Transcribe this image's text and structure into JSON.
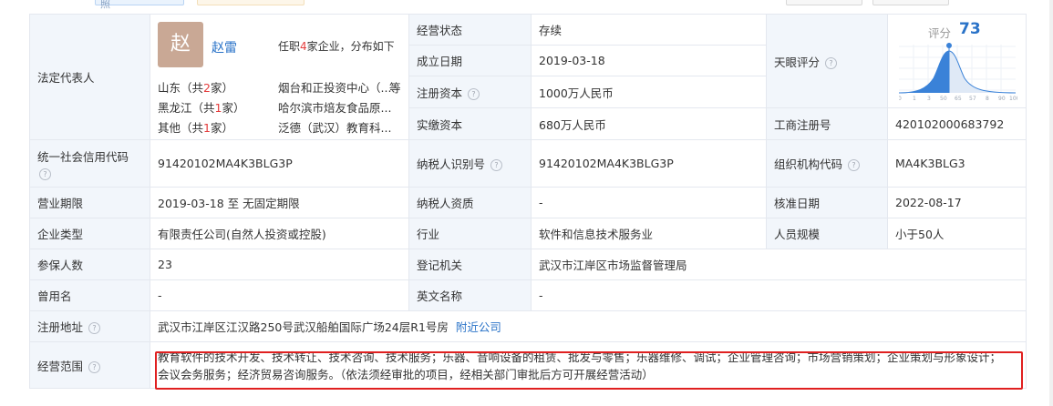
{
  "top_bar": {
    "photo_fragment": "照"
  },
  "legal_rep": {
    "label": "法定代表人",
    "avatar_char": "赵",
    "name": "赵雷",
    "role_prefix": "任职",
    "role_count": "4",
    "role_suffix": "家企业，分布如下",
    "regions": [
      {
        "pre": "山东（共",
        "count": "2",
        "post": "家）",
        "company": "烟台和正投资中心（...",
        "more": "等"
      },
      {
        "pre": "黑龙江（共",
        "count": "1",
        "post": "家）",
        "company": "哈尔滨市焙友食品原...",
        "more": ""
      },
      {
        "pre": "其他（共",
        "count": "1",
        "post": "家）",
        "company": "泛德（武汉）教育科...",
        "more": ""
      }
    ]
  },
  "status": {
    "label": "经营状态",
    "value": "存续"
  },
  "established": {
    "label": "成立日期",
    "value": "2019-03-18"
  },
  "reg_capital": {
    "label": "注册资本",
    "value": "1000万人民币"
  },
  "paid_capital": {
    "label": "实缴资本",
    "value": "680万人民币"
  },
  "tianyan": {
    "label": "天眼评分",
    "score_label": "评分",
    "score": 73,
    "axis_ticks": [
      "0",
      "1",
      "3",
      "50",
      "65",
      "57",
      "8",
      "90",
      "100"
    ]
  },
  "biz_reg_no": {
    "label": "工商注册号",
    "value": "420102000683792"
  },
  "credit_code": {
    "label": "统一社会信用代码",
    "value": "91420102MA4K3BLG3P"
  },
  "taxpayer_id": {
    "label": "纳税人识别号",
    "value": "91420102MA4K3BLG3P"
  },
  "org_code": {
    "label": "组织机构代码",
    "value": "MA4K3BLG3"
  },
  "term": {
    "label": "营业期限",
    "value": "2019-03-18 至 无固定期限"
  },
  "taxpayer_qual": {
    "label": "纳税人资质",
    "value": "-"
  },
  "approval_date": {
    "label": "核准日期",
    "value": "2022-08-17"
  },
  "company_type": {
    "label": "企业类型",
    "value": "有限责任公司(自然人投资或控股)"
  },
  "industry": {
    "label": "行业",
    "value": "软件和信息技术服务业"
  },
  "staff_size": {
    "label": "人员规模",
    "value": "小于50人"
  },
  "insured": {
    "label": "参保人数",
    "value": "23"
  },
  "reg_authority": {
    "label": "登记机关",
    "value": "武汉市江岸区市场监督管理局"
  },
  "former_name": {
    "label": "曾用名",
    "value": "-"
  },
  "english_name": {
    "label": "英文名称",
    "value": "-"
  },
  "address": {
    "label": "注册地址",
    "value": "武汉市江岸区江汉路250号武汉船舶国际广场24层R1号房",
    "nearby": "附近公司"
  },
  "scope": {
    "label": "经营范围",
    "line1": "教育软件的技术开发、技术转让、技术咨询、技术服务；乐器、音响设备的租赁、批发与零售；乐器维修、调试；企业管理咨询；市场营销策划；企业策划与形象设计；",
    "line2": "会议会务服务；经济贸易咨询服务。（依法须经审批的项目，经相关部门审批后方可开展经营活动）"
  },
  "colors": {
    "label_bg": "#f2f6fb",
    "border": "#e4e8ef",
    "link": "#2a73c8",
    "highlight": "#e02020"
  }
}
